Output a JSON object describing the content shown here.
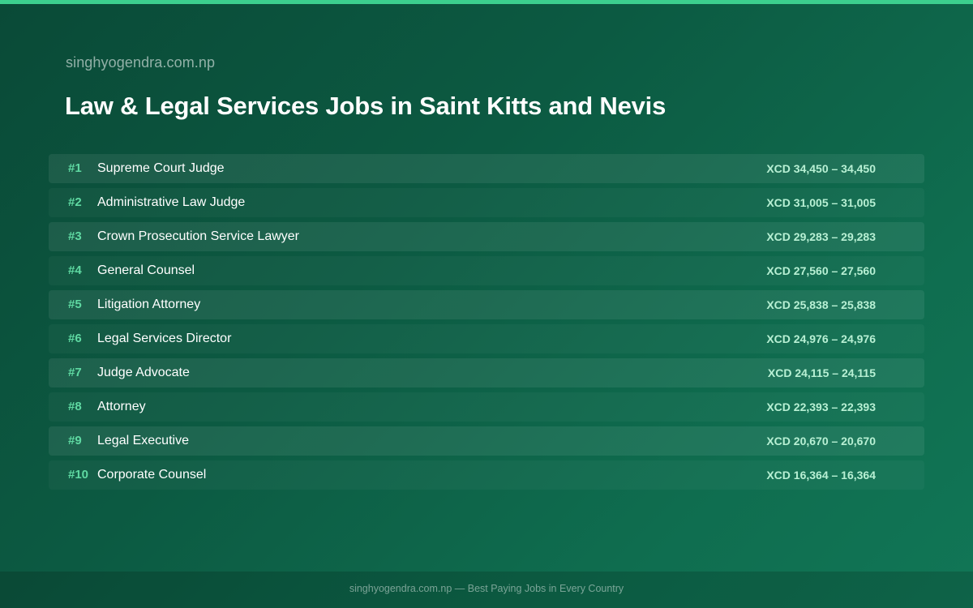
{
  "header": {
    "site_name": "singhyogendra.com.np",
    "title": "Law & Legal Services Jobs in Saint Kitts and Nevis"
  },
  "jobs": [
    {
      "rank": "#1",
      "title": "Supreme Court Judge",
      "salary": "XCD 34,450 – 34,450"
    },
    {
      "rank": "#2",
      "title": "Administrative Law Judge",
      "salary": "XCD 31,005 – 31,005"
    },
    {
      "rank": "#3",
      "title": "Crown Prosecution Service Lawyer",
      "salary": "XCD 29,283 – 29,283"
    },
    {
      "rank": "#4",
      "title": "General Counsel",
      "salary": "XCD 27,560 – 27,560"
    },
    {
      "rank": "#5",
      "title": "Litigation Attorney",
      "salary": "XCD 25,838 – 25,838"
    },
    {
      "rank": "#6",
      "title": "Legal Services Director",
      "salary": "XCD 24,976 – 24,976"
    },
    {
      "rank": "#7",
      "title": "Judge Advocate",
      "salary": "XCD 24,115 – 24,115"
    },
    {
      "rank": "#8",
      "title": "Attorney",
      "salary": "XCD 22,393 – 22,393"
    },
    {
      "rank": "#9",
      "title": "Legal Executive",
      "salary": "XCD 20,670 – 20,670"
    },
    {
      "rank": "#10",
      "title": "Corporate Counsel",
      "salary": "XCD 16,364 – 16,364"
    }
  ],
  "footer": {
    "text": "singhyogendra.com.np — Best Paying Jobs in Every Country"
  },
  "colors": {
    "accent": "#3ccf8e",
    "rank": "#5fd9a2",
    "salary": "#b8f0d4",
    "background": "#0c5a42"
  }
}
